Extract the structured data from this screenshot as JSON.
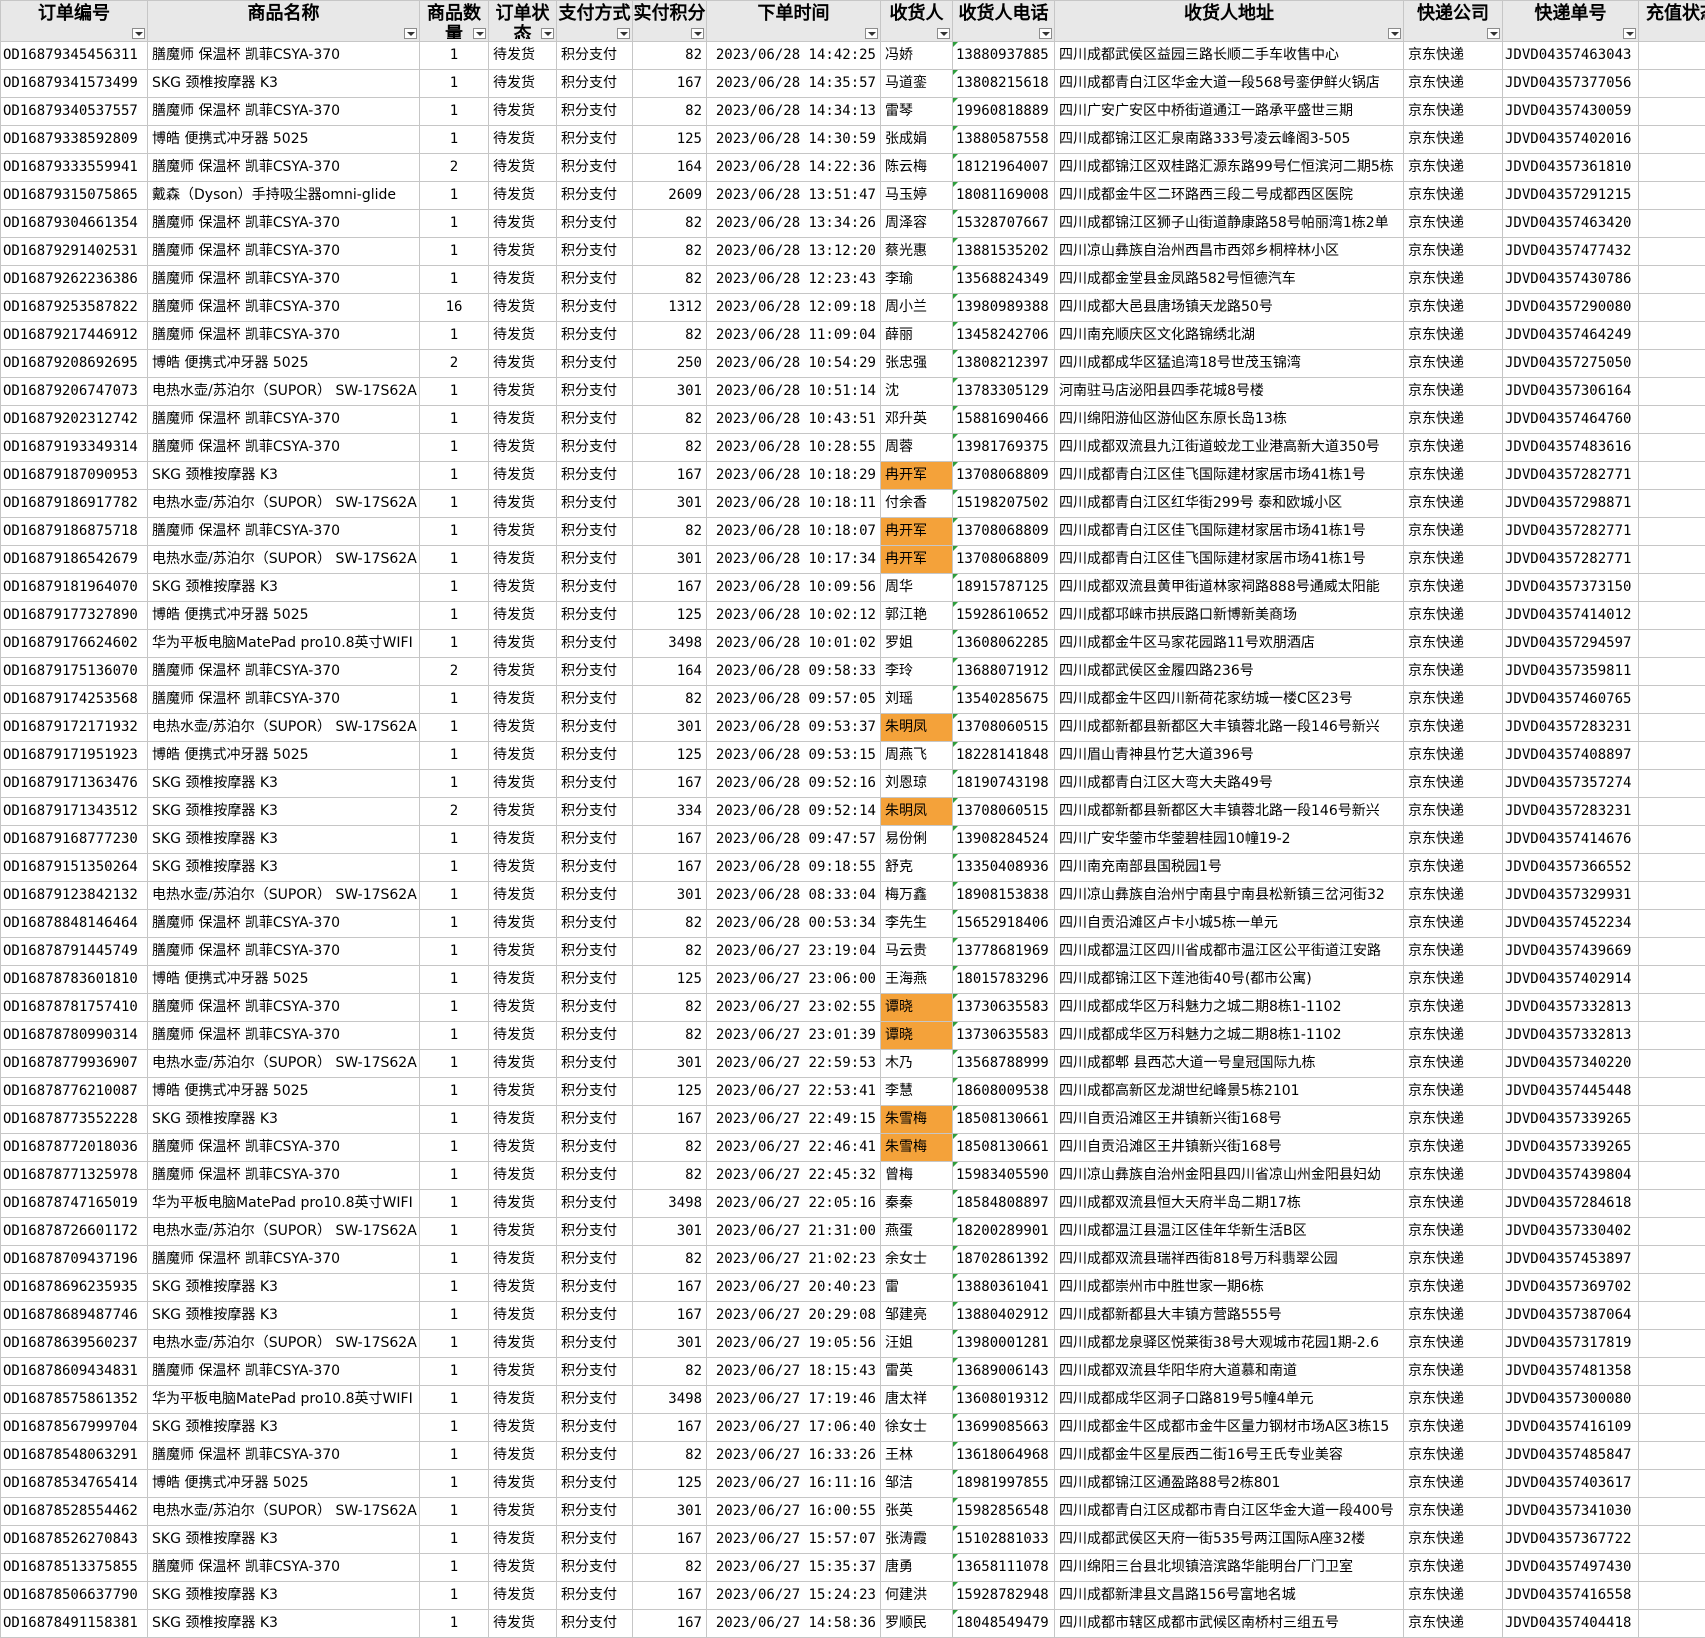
{
  "headers": [
    "订单编号",
    "商品名称",
    "商品数量",
    "订单状态",
    "支付方式",
    "实付积分",
    "下单时间",
    "收货人",
    "收货人电话",
    "收货人地址",
    "快递公司",
    "快递单号",
    "充值状态"
  ],
  "rows": [
    [
      "OD16879345456311",
      "膳魔师 保温杯 凯菲CSYA-370",
      "1",
      "待发货",
      "积分支付",
      "82",
      "2023/06/28 14:42:25",
      "冯娇",
      "13880937885",
      "四川成都武侯区益园三路长顺二手车收售中心",
      "京东快递",
      "JDVD04357463043"
    ],
    [
      "OD16879341573499",
      "SKG 颈椎按摩器 K3",
      "1",
      "待发货",
      "积分支付",
      "167",
      "2023/06/28 14:35:57",
      "马道銮",
      "13808215618",
      "四川成都青白江区华金大道一段568号銮伊鲜火锅店",
      "京东快递",
      "JDVD04357377056"
    ],
    [
      "OD16879340537557",
      "膳魔师 保温杯 凯菲CSYA-370",
      "1",
      "待发货",
      "积分支付",
      "82",
      "2023/06/28 14:34:13",
      "雷琴",
      "19960818889",
      "四川广安广安区中桥街道通江一路承平盛世三期",
      "京东快递",
      "JDVD04357430059"
    ],
    [
      "OD16879338592809",
      "博皓 便携式冲牙器 5025",
      "1",
      "待发货",
      "积分支付",
      "125",
      "2023/06/28 14:30:59",
      "张成娟",
      "13880587558",
      "四川成都锦江区汇泉南路333号凌云峰阁3-505",
      "京东快递",
      "JDVD04357402016"
    ],
    [
      "OD16879333559941",
      "膳魔师 保温杯 凯菲CSYA-370",
      "2",
      "待发货",
      "积分支付",
      "164",
      "2023/06/28 14:22:36",
      "陈云梅",
      "18121964007",
      "四川成都锦江区双桂路汇源东路99号仁恒滨河二期5栋",
      "京东快递",
      "JDVD04357361810"
    ],
    [
      "OD16879315075865",
      "戴森（Dyson）手持吸尘器omni-glide",
      "1",
      "待发货",
      "积分支付",
      "2609",
      "2023/06/28 13:51:47",
      "马玉婷",
      "18081169008",
      "四川成都金牛区二环路西三段二号成都西区医院",
      "京东快递",
      "JDVD04357291215"
    ],
    [
      "OD16879304661354",
      "膳魔师 保温杯 凯菲CSYA-370",
      "1",
      "待发货",
      "积分支付",
      "82",
      "2023/06/28 13:34:26",
      "周泽容",
      "15328707667",
      "四川成都锦江区狮子山街道静康路58号帕丽湾1栋2单",
      "京东快递",
      "JDVD04357463420"
    ],
    [
      "OD16879291402531",
      "膳魔师 保温杯 凯菲CSYA-370",
      "1",
      "待发货",
      "积分支付",
      "82",
      "2023/06/28 13:12:20",
      "蔡光惠",
      "13881535202",
      "四川凉山彝族自治州西昌市西郊乡桐梓林小区",
      "京东快递",
      "JDVD04357477432"
    ],
    [
      "OD16879262236386",
      "膳魔师 保温杯 凯菲CSYA-370",
      "1",
      "待发货",
      "积分支付",
      "82",
      "2023/06/28 12:23:43",
      "李瑜",
      "13568824349",
      "四川成都金堂县金凤路582号恒德汽车",
      "京东快递",
      "JDVD04357430786"
    ],
    [
      "OD16879253587822",
      "膳魔师 保温杯 凯菲CSYA-370",
      "16",
      "待发货",
      "积分支付",
      "1312",
      "2023/06/28 12:09:18",
      "周小兰",
      "13980989388",
      "四川成都大邑县唐场镇天龙路50号",
      "京东快递",
      "JDVD04357290080"
    ],
    [
      "OD16879217446912",
      "膳魔师 保温杯 凯菲CSYA-370",
      "1",
      "待发货",
      "积分支付",
      "82",
      "2023/06/28 11:09:04",
      "薛丽",
      "13458242706",
      "四川南充顺庆区文化路锦绣北湖",
      "京东快递",
      "JDVD04357464249"
    ],
    [
      "OD16879208692695",
      "博皓 便携式冲牙器 5025",
      "2",
      "待发货",
      "积分支付",
      "250",
      "2023/06/28 10:54:29",
      "张忠强",
      "13808212397",
      "四川成都成华区猛追湾18号世茂玉锦湾",
      "京东快递",
      "JDVD04357275050"
    ],
    [
      "OD16879206747073",
      "电热水壶/苏泊尔（SUPOR） SW-17S62A",
      "1",
      "待发货",
      "积分支付",
      "301",
      "2023/06/28 10:51:14",
      "沈",
      "13783305129",
      "河南驻马店泌阳县四季花城8号楼",
      "京东快递",
      "JDVD04357306164"
    ],
    [
      "OD16879202312742",
      "膳魔师 保温杯 凯菲CSYA-370",
      "1",
      "待发货",
      "积分支付",
      "82",
      "2023/06/28 10:43:51",
      "邓升英",
      "15881690466",
      "四川绵阳游仙区游仙区东原长岛13栋",
      "京东快递",
      "JDVD04357464760"
    ],
    [
      "OD16879193349314",
      "膳魔师 保温杯 凯菲CSYA-370",
      "1",
      "待发货",
      "积分支付",
      "82",
      "2023/06/28 10:28:55",
      "周蓉",
      "13981769375",
      "四川成都双流县九江街道蛟龙工业港高新大道350号",
      "京东快递",
      "JDVD04357483616"
    ],
    [
      "OD16879187090953",
      "SKG 颈椎按摩器 K3",
      "1",
      "待发货",
      "积分支付",
      "167",
      "2023/06/28 10:18:29",
      "冉开军",
      "13708068809",
      "四川成都青白江区佳飞国际建材家居市场41栋1号",
      "京东快递",
      "JDVD04357282771"
    ],
    [
      "OD16879186917782",
      "电热水壶/苏泊尔（SUPOR） SW-17S62A",
      "1",
      "待发货",
      "积分支付",
      "301",
      "2023/06/28 10:18:11",
      "付余香",
      "15198207502",
      "四川成都青白江区红华街299号 泰和欧城小区",
      "京东快递",
      "JDVD04357298871"
    ],
    [
      "OD16879186875718",
      "膳魔师 保温杯 凯菲CSYA-370",
      "1",
      "待发货",
      "积分支付",
      "82",
      "2023/06/28 10:18:07",
      "冉开军",
      "13708068809",
      "四川成都青白江区佳飞国际建材家居市场41栋1号",
      "京东快递",
      "JDVD04357282771"
    ],
    [
      "OD16879186542679",
      "电热水壶/苏泊尔（SUPOR） SW-17S62A",
      "1",
      "待发货",
      "积分支付",
      "301",
      "2023/06/28 10:17:34",
      "冉开军",
      "13708068809",
      "四川成都青白江区佳飞国际建材家居市场41栋1号",
      "京东快递",
      "JDVD04357282771"
    ],
    [
      "OD16879181964070",
      "SKG 颈椎按摩器 K3",
      "1",
      "待发货",
      "积分支付",
      "167",
      "2023/06/28 10:09:56",
      "周华",
      "18915787125",
      "四川成都双流县黄甲街道林家祠路888号通威太阳能",
      "京东快递",
      "JDVD04357373150"
    ],
    [
      "OD16879177327890",
      "博皓 便携式冲牙器 5025",
      "1",
      "待发货",
      "积分支付",
      "125",
      "2023/06/28 10:02:12",
      "郭江艳",
      "15928610652",
      "四川成都邛崃市拱辰路口新博新美商场",
      "京东快递",
      "JDVD04357414012"
    ],
    [
      "OD16879176624602",
      "华为平板电脑MatePad pro10.8英寸WIFI",
      "1",
      "待发货",
      "积分支付",
      "3498",
      "2023/06/28 10:01:02",
      "罗姐",
      "13608062285",
      "四川成都金牛区马家花园路11号欢朋酒店",
      "京东快递",
      "JDVD04357294597"
    ],
    [
      "OD16879175136070",
      "膳魔师 保温杯 凯菲CSYA-370",
      "2",
      "待发货",
      "积分支付",
      "164",
      "2023/06/28 09:58:33",
      "李玲",
      "13688071912",
      "四川成都武侯区金履四路236号",
      "京东快递",
      "JDVD04357359811"
    ],
    [
      "OD16879174253568",
      "膳魔师 保温杯 凯菲CSYA-370",
      "1",
      "待发货",
      "积分支付",
      "82",
      "2023/06/28 09:57:05",
      "刘瑶",
      "13540285675",
      "四川成都金牛区四川新荷花家纺城一楼C区23号",
      "京东快递",
      "JDVD04357460765"
    ],
    [
      "OD16879172171932",
      "电热水壶/苏泊尔（SUPOR） SW-17S62A",
      "1",
      "待发货",
      "积分支付",
      "301",
      "2023/06/28 09:53:37",
      "朱明凤",
      "13708060515",
      "四川成都新都县新都区大丰镇蓉北路一段146号新兴",
      "京东快递",
      "JDVD04357283231"
    ],
    [
      "OD16879171951923",
      "博皓 便携式冲牙器 5025",
      "1",
      "待发货",
      "积分支付",
      "125",
      "2023/06/28 09:53:15",
      "周燕飞",
      "18228141848",
      "四川眉山青神县竹艺大道396号",
      "京东快递",
      "JDVD04357408897"
    ],
    [
      "OD16879171363476",
      "SKG 颈椎按摩器 K3",
      "1",
      "待发货",
      "积分支付",
      "167",
      "2023/06/28 09:52:16",
      "刘恩琼",
      "18190743198",
      "四川成都青白江区大弯大夫路49号",
      "京东快递",
      "JDVD04357357274"
    ],
    [
      "OD16879171343512",
      "SKG 颈椎按摩器 K3",
      "2",
      "待发货",
      "积分支付",
      "334",
      "2023/06/28 09:52:14",
      "朱明凤",
      "13708060515",
      "四川成都新都县新都区大丰镇蓉北路一段146号新兴",
      "京东快递",
      "JDVD04357283231"
    ],
    [
      "OD16879168777230",
      "SKG 颈椎按摩器 K3",
      "1",
      "待发货",
      "积分支付",
      "167",
      "2023/06/28 09:47:57",
      "易份俐",
      "13908284524",
      "四川广安华蓥市华蓥碧桂园10幢19-2",
      "京东快递",
      "JDVD04357414676"
    ],
    [
      "OD16879151350264",
      "SKG 颈椎按摩器 K3",
      "1",
      "待发货",
      "积分支付",
      "167",
      "2023/06/28 09:18:55",
      "舒克",
      "13350408936",
      "四川南充南部县国税园1号",
      "京东快递",
      "JDVD04357366552"
    ],
    [
      "OD16879123842132",
      "电热水壶/苏泊尔（SUPOR） SW-17S62A",
      "1",
      "待发货",
      "积分支付",
      "301",
      "2023/06/28 08:33:04",
      "梅万鑫",
      "18908153838",
      "四川凉山彝族自治州宁南县宁南县松新镇三岔河街32",
      "京东快递",
      "JDVD04357329931"
    ],
    [
      "OD16878848146464",
      "膳魔师 保温杯 凯菲CSYA-370",
      "1",
      "待发货",
      "积分支付",
      "82",
      "2023/06/28 00:53:34",
      "李先生",
      "15652918406",
      "四川自贡沿滩区卢卡小城5栋一单元",
      "京东快递",
      "JDVD04357452234"
    ],
    [
      "OD16878791445749",
      "膳魔师 保温杯 凯菲CSYA-370",
      "1",
      "待发货",
      "积分支付",
      "82",
      "2023/06/27 23:19:04",
      "马云贵",
      "13778681969",
      "四川成都温江区四川省成都市温江区公平街道江安路",
      "京东快递",
      "JDVD04357439669"
    ],
    [
      "OD16878783601810",
      "博皓 便携式冲牙器 5025",
      "1",
      "待发货",
      "积分支付",
      "125",
      "2023/06/27 23:06:00",
      "王海燕",
      "18015783296",
      "四川成都锦江区下莲池街40号(都市公寓)",
      "京东快递",
      "JDVD04357402914"
    ],
    [
      "OD16878781757410",
      "膳魔师 保温杯 凯菲CSYA-370",
      "1",
      "待发货",
      "积分支付",
      "82",
      "2023/06/27 23:02:55",
      "谭晓",
      "13730635583",
      "四川成都成华区万科魅力之城二期8栋1-1102",
      "京东快递",
      "JDVD04357332813"
    ],
    [
      "OD16878780990314",
      "膳魔师 保温杯 凯菲CSYA-370",
      "1",
      "待发货",
      "积分支付",
      "82",
      "2023/06/27 23:01:39",
      "谭晓",
      "13730635583",
      "四川成都成华区万科魅力之城二期8栋1-1102",
      "京东快递",
      "JDVD04357332813"
    ],
    [
      "OD16878779936907",
      "电热水壶/苏泊尔（SUPOR） SW-17S62A",
      "1",
      "待发货",
      "积分支付",
      "301",
      "2023/06/27 22:59:53",
      "木乃",
      "13568788999",
      "四川成都郫 县西芯大道一号皇冠国际九栋",
      "京东快递",
      "JDVD04357340220"
    ],
    [
      "OD16878776210087",
      "博皓 便携式冲牙器 5025",
      "1",
      "待发货",
      "积分支付",
      "125",
      "2023/06/27 22:53:41",
      "李慧",
      "18608009538",
      "四川成都高新区龙湖世纪峰景5栋2101",
      "京东快递",
      "JDVD04357445448"
    ],
    [
      "OD16878773552228",
      "SKG 颈椎按摩器 K3",
      "1",
      "待发货",
      "积分支付",
      "167",
      "2023/06/27 22:49:15",
      "朱雪梅",
      "18508130661",
      "四川自贡沿滩区王井镇新兴街168号",
      "京东快递",
      "JDVD04357339265"
    ],
    [
      "OD16878772018036",
      "膳魔师 保温杯 凯菲CSYA-370",
      "1",
      "待发货",
      "积分支付",
      "82",
      "2023/06/27 22:46:41",
      "朱雪梅",
      "18508130661",
      "四川自贡沿滩区王井镇新兴街168号",
      "京东快递",
      "JDVD04357339265"
    ],
    [
      "OD16878771325978",
      "膳魔师 保温杯 凯菲CSYA-370",
      "1",
      "待发货",
      "积分支付",
      "82",
      "2023/06/27 22:45:32",
      "曾梅",
      "15983405590",
      "四川凉山彝族自治州金阳县四川省凉山州金阳县妇幼",
      "京东快递",
      "JDVD04357439804"
    ],
    [
      "OD16878747165019",
      "华为平板电脑MatePad pro10.8英寸WIFI",
      "1",
      "待发货",
      "积分支付",
      "3498",
      "2023/06/27 22:05:16",
      "秦秦",
      "18584808897",
      "四川成都双流县恒大天府半岛二期17栋",
      "京东快递",
      "JDVD04357284618"
    ],
    [
      "OD16878726601172",
      "电热水壶/苏泊尔（SUPOR） SW-17S62A",
      "1",
      "待发货",
      "积分支付",
      "301",
      "2023/06/27 21:31:00",
      "燕蛋",
      "18200289901",
      "四川成都温江县温江区佳年华新生活B区",
      "京东快递",
      "JDVD04357330402"
    ],
    [
      "OD16878709437196",
      "膳魔师 保温杯 凯菲CSYA-370",
      "1",
      "待发货",
      "积分支付",
      "82",
      "2023/06/27 21:02:23",
      "余女士",
      "18702861392",
      "四川成都双流县瑞祥西街818号万科翡翠公园",
      "京东快递",
      "JDVD04357453897"
    ],
    [
      "OD16878696235935",
      "SKG 颈椎按摩器 K3",
      "1",
      "待发货",
      "积分支付",
      "167",
      "2023/06/27 20:40:23",
      "雷",
      "13880361041",
      "四川成都崇州市中胜世家一期6栋",
      "京东快递",
      "JDVD04357369702"
    ],
    [
      "OD16878689487746",
      "SKG 颈椎按摩器 K3",
      "1",
      "待发货",
      "积分支付",
      "167",
      "2023/06/27 20:29:08",
      "邹建亮",
      "13880402912",
      "四川成都新都县大丰镇方营路555号",
      "京东快递",
      "JDVD04357387064"
    ],
    [
      "OD16878639560237",
      "电热水壶/苏泊尔（SUPOR） SW-17S62A",
      "1",
      "待发货",
      "积分支付",
      "301",
      "2023/06/27 19:05:56",
      "汪姐",
      "13980001281",
      "四川成都龙泉驿区悦莱街38号大观城市花园1期-2.6",
      "京东快递",
      "JDVD04357317819"
    ],
    [
      "OD16878609434831",
      "膳魔师 保温杯 凯菲CSYA-370",
      "1",
      "待发货",
      "积分支付",
      "82",
      "2023/06/27 18:15:43",
      "雷英",
      "13689006143",
      "四川成都双流县华阳华府大道慕和南道",
      "京东快递",
      "JDVD04357481358"
    ],
    [
      "OD16878575861352",
      "华为平板电脑MatePad pro10.8英寸WIFI",
      "1",
      "待发货",
      "积分支付",
      "3498",
      "2023/06/27 17:19:46",
      "唐太祥",
      "13608019312",
      "四川成都成华区洞子口路819号5幢4单元",
      "京东快递",
      "JDVD04357300080"
    ],
    [
      "OD16878567999704",
      "SKG 颈椎按摩器 K3",
      "1",
      "待发货",
      "积分支付",
      "167",
      "2023/06/27 17:06:40",
      "徐女士",
      "13699085663",
      "四川成都金牛区成都市金牛区量力钢材市场A区3栋15",
      "京东快递",
      "JDVD04357416109"
    ],
    [
      "OD16878548063291",
      "膳魔师 保温杯 凯菲CSYA-370",
      "1",
      "待发货",
      "积分支付",
      "82",
      "2023/06/27 16:33:26",
      "王林",
      "13618064968",
      "四川成都金牛区星辰西二街16号王氏专业美容",
      "京东快递",
      "JDVD04357485847"
    ],
    [
      "OD16878534765414",
      "博皓 便携式冲牙器 5025",
      "1",
      "待发货",
      "积分支付",
      "125",
      "2023/06/27 16:11:16",
      "邹洁",
      "18981997855",
      "四川成都锦江区通盈路88号2栋801",
      "京东快递",
      "JDVD04357403617"
    ],
    [
      "OD16878528554462",
      "电热水壶/苏泊尔（SUPOR） SW-17S62A",
      "1",
      "待发货",
      "积分支付",
      "301",
      "2023/06/27 16:00:55",
      "张英",
      "15982856548",
      "四川成都青白江区成都市青白江区华金大道一段400号",
      "京东快递",
      "JDVD04357341030"
    ],
    [
      "OD16878526270843",
      "SKG 颈椎按摩器 K3",
      "1",
      "待发货",
      "积分支付",
      "167",
      "2023/06/27 15:57:07",
      "张涛霞",
      "15102881033",
      "四川成都武侯区天府一街535号两江国际A座32楼",
      "京东快递",
      "JDVD04357367722"
    ],
    [
      "OD16878513375855",
      "膳魔师 保温杯 凯菲CSYA-370",
      "1",
      "待发货",
      "积分支付",
      "82",
      "2023/06/27 15:35:37",
      "唐勇",
      "13658111078",
      "四川绵阳三台县北坝镇涪滨路华能明台厂门卫室",
      "京东快递",
      "JDVD04357497430"
    ],
    [
      "OD16878506637790",
      "SKG 颈椎按摩器 K3",
      "1",
      "待发货",
      "积分支付",
      "167",
      "2023/06/27 15:24:23",
      "何建洪",
      "15928782948",
      "四川成都新津县文昌路156号富地名城",
      "京东快递",
      "JDVD04357416558"
    ],
    [
      "OD16878491158381",
      "SKG 颈椎按摩器 K3",
      "1",
      "待发货",
      "积分支付",
      "167",
      "2023/06/27 14:58:36",
      "罗顺民",
      "18048549479",
      "四川成都市辖区成都市武候区南桥村三组五号",
      "京东快递",
      "JDVD04357404418"
    ]
  ],
  "highlighted_receivers": [
    "冉开军",
    "朱明凤",
    "谭晓",
    "朱雪梅"
  ],
  "colors": {
    "highlight": "#f4a23a",
    "header_bg": "#e8e8e8",
    "grid": "#c6c6c6",
    "comment_mark": "#2e9e3c"
  }
}
